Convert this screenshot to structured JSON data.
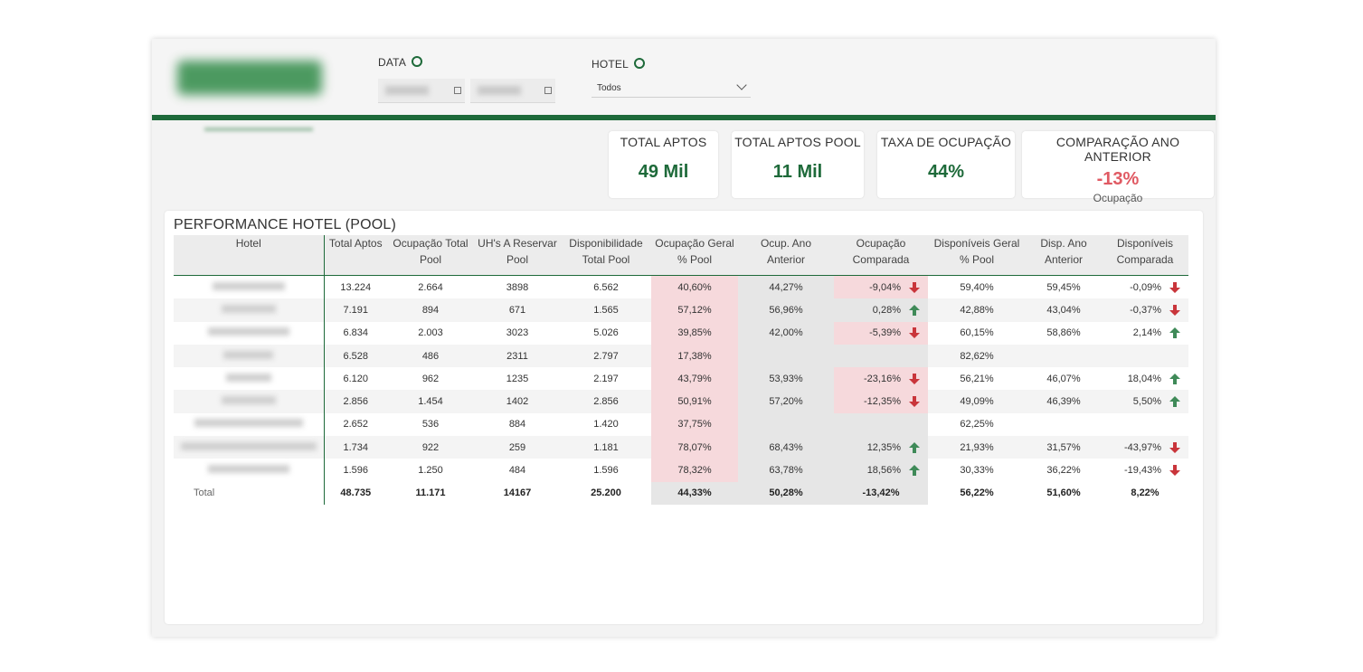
{
  "filters": {
    "data_label": "DATA",
    "hotel_label": "HOTEL",
    "hotel_selected": "Todos"
  },
  "kpis": [
    {
      "title": "TOTAL APTOS",
      "value": "49 Mil"
    },
    {
      "title": "TOTAL APTOS POOL",
      "value": "11 Mil"
    },
    {
      "title": "TAXA DE OCUPAÇÃO",
      "value": "44%"
    },
    {
      "title": "COMPARAÇÃO ANO ANTERIOR",
      "value": "-13%",
      "sub": "Ocupação"
    }
  ],
  "table": {
    "title": "PERFORMANCE HOTEL (POOL)",
    "headers": [
      {
        "l1": "Hotel",
        "l2": ""
      },
      {
        "l1": "Total Aptos",
        "l2": ""
      },
      {
        "l1": "Ocupação Total",
        "l2": "Pool"
      },
      {
        "l1": "UH's A Reservar",
        "l2": "Pool"
      },
      {
        "l1": "Disponibilidade",
        "l2": "Total Pool"
      },
      {
        "l1": "Ocupação Geral",
        "l2": "% Pool"
      },
      {
        "l1": "Ocup. Ano",
        "l2": "Anterior"
      },
      {
        "l1": "Ocupação",
        "l2": "Comparada"
      },
      {
        "l1": "Disponíveis Geral",
        "l2": "% Pool"
      },
      {
        "l1": "Disp. Ano",
        "l2": "Anterior"
      },
      {
        "l1": "Disponíveis",
        "l2": "Comparada"
      }
    ],
    "rows": [
      {
        "total_aptos": "13.224",
        "ocup_total": "2.664",
        "uh_reservar": "3898",
        "disp_total": "6.562",
        "ocup_geral": "40,60%",
        "ocup_ano_ant": "44,27%",
        "ocup_comp": "-9,04%",
        "ocup_dir": "down",
        "disp_geral": "59,40%",
        "disp_ano_ant": "59,45%",
        "disp_comp": "-0,09%",
        "disp_dir": "down"
      },
      {
        "total_aptos": "7.191",
        "ocup_total": "894",
        "uh_reservar": "671",
        "disp_total": "1.565",
        "ocup_geral": "57,12%",
        "ocup_ano_ant": "56,96%",
        "ocup_comp": "0,28%",
        "ocup_dir": "up",
        "disp_geral": "42,88%",
        "disp_ano_ant": "43,04%",
        "disp_comp": "-0,37%",
        "disp_dir": "down"
      },
      {
        "total_aptos": "6.834",
        "ocup_total": "2.003",
        "uh_reservar": "3023",
        "disp_total": "5.026",
        "ocup_geral": "39,85%",
        "ocup_ano_ant": "42,00%",
        "ocup_comp": "-5,39%",
        "ocup_dir": "down",
        "disp_geral": "60,15%",
        "disp_ano_ant": "58,86%",
        "disp_comp": "2,14%",
        "disp_dir": "up"
      },
      {
        "total_aptos": "6.528",
        "ocup_total": "486",
        "uh_reservar": "2311",
        "disp_total": "2.797",
        "ocup_geral": "17,38%",
        "ocup_ano_ant": "",
        "ocup_comp": "",
        "ocup_dir": "",
        "disp_geral": "82,62%",
        "disp_ano_ant": "",
        "disp_comp": "",
        "disp_dir": ""
      },
      {
        "total_aptos": "6.120",
        "ocup_total": "962",
        "uh_reservar": "1235",
        "disp_total": "2.197",
        "ocup_geral": "43,79%",
        "ocup_ano_ant": "53,93%",
        "ocup_comp": "-23,16%",
        "ocup_dir": "down",
        "disp_geral": "56,21%",
        "disp_ano_ant": "46,07%",
        "disp_comp": "18,04%",
        "disp_dir": "up"
      },
      {
        "total_aptos": "2.856",
        "ocup_total": "1.454",
        "uh_reservar": "1402",
        "disp_total": "2.856",
        "ocup_geral": "50,91%",
        "ocup_ano_ant": "57,20%",
        "ocup_comp": "-12,35%",
        "ocup_dir": "down",
        "disp_geral": "49,09%",
        "disp_ano_ant": "46,39%",
        "disp_comp": "5,50%",
        "disp_dir": "up"
      },
      {
        "total_aptos": "2.652",
        "ocup_total": "536",
        "uh_reservar": "884",
        "disp_total": "1.420",
        "ocup_geral": "37,75%",
        "ocup_ano_ant": "",
        "ocup_comp": "",
        "ocup_dir": "",
        "disp_geral": "62,25%",
        "disp_ano_ant": "",
        "disp_comp": "",
        "disp_dir": ""
      },
      {
        "total_aptos": "1.734",
        "ocup_total": "922",
        "uh_reservar": "259",
        "disp_total": "1.181",
        "ocup_geral": "78,07%",
        "ocup_ano_ant": "68,43%",
        "ocup_comp": "12,35%",
        "ocup_dir": "up",
        "disp_geral": "21,93%",
        "disp_ano_ant": "31,57%",
        "disp_comp": "-43,97%",
        "disp_dir": "down"
      },
      {
        "total_aptos": "1.596",
        "ocup_total": "1.250",
        "uh_reservar": "484",
        "disp_total": "1.596",
        "ocup_geral": "78,32%",
        "ocup_ano_ant": "63,78%",
        "ocup_comp": "18,56%",
        "ocup_dir": "up",
        "disp_geral": "30,33%",
        "disp_ano_ant": "36,22%",
        "disp_comp": "-19,43%",
        "disp_dir": "down"
      }
    ],
    "total": {
      "label": "Total",
      "total_aptos": "48.735",
      "ocup_total": "11.171",
      "uh_reservar": "14167",
      "disp_total": "25.200",
      "ocup_geral": "44,33%",
      "ocup_ano_ant": "50,28%",
      "ocup_comp": "-13,42%",
      "disp_geral": "56,22%",
      "disp_ano_ant": "51,60%",
      "disp_comp": "8,22%"
    }
  },
  "colors": {
    "brand_green": "#1e6a3a",
    "down_red": "#c9353b",
    "up_green": "#3f8a58",
    "kpi_red": "#e05a63"
  }
}
